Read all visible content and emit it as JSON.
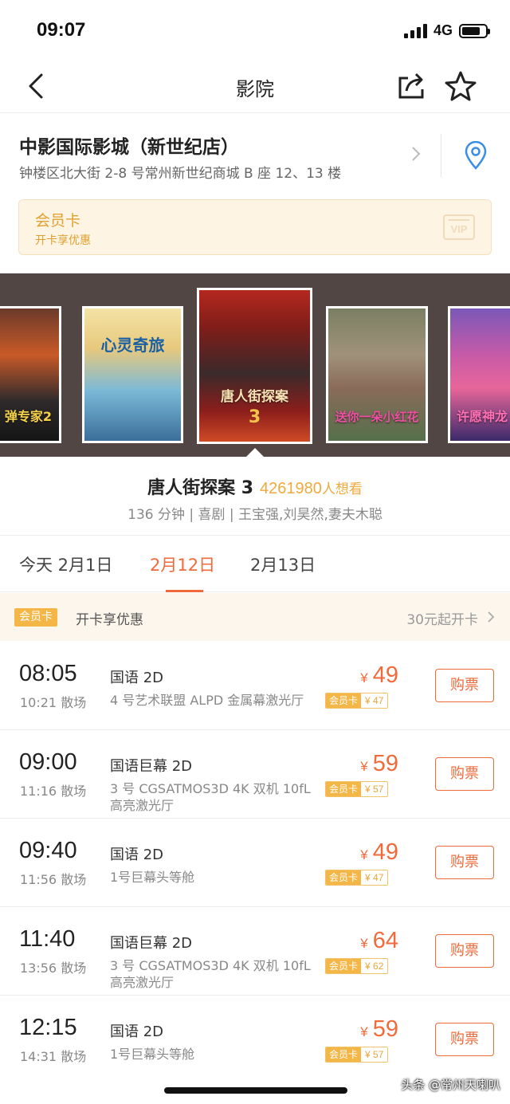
{
  "status_bar": {
    "time": "09:07",
    "network": "4G"
  },
  "nav": {
    "title": "影院",
    "icons": [
      "back-icon",
      "share-icon",
      "star-icon"
    ]
  },
  "cinema": {
    "name": "中影国际影城（新世纪店）",
    "address": "钟楼区北大街 2-8 号常州新世纪商城 B 座 12、13 楼"
  },
  "member_card": {
    "title": "会员卡",
    "subtitle": "开卡享优惠",
    "icon_text": "VIP"
  },
  "posters": [
    {
      "label": "弹专家2"
    },
    {
      "label": "心灵奇旅"
    },
    {
      "label": "唐人街探案",
      "number": "3"
    },
    {
      "label": "送你一朵小红花"
    },
    {
      "label": "许愿神龙"
    }
  ],
  "movie": {
    "title": "唐人街探案 3",
    "wants": "4261980",
    "wants_suffix": "人想看",
    "meta": "136 分钟 | 喜剧 | 王宝强,刘昊然,妻夫木聪"
  },
  "date_tabs": [
    {
      "label": "今天 2月1日",
      "active": false
    },
    {
      "label": "2月12日",
      "active": true
    },
    {
      "label": "2月13日",
      "active": false
    }
  ],
  "promo": {
    "badge": "会员卡",
    "text": "开卡享优惠",
    "right": "30元起开卡"
  },
  "currency": "¥",
  "member_tag": "会员卡",
  "buy_label": "购票",
  "showtimes": [
    {
      "start": "08:05",
      "end": "10:21 散场",
      "format": "国语 2D",
      "hall": "4 号艺术联盟 ALPD 金属幕激光厅",
      "price": "49",
      "member_price": "¥ 47"
    },
    {
      "start": "09:00",
      "end": "11:16 散场",
      "format": "国语巨幕 2D",
      "hall": "3 号 CGSATMOS3D 4K 双机 10fL 高亮激光厅",
      "price": "59",
      "member_price": "¥ 57"
    },
    {
      "start": "09:40",
      "end": "11:56 散场",
      "format": "国语 2D",
      "hall": "1号巨幕头等舱",
      "price": "49",
      "member_price": "¥ 47"
    },
    {
      "start": "11:40",
      "end": "13:56 散场",
      "format": "国语巨幕 2D",
      "hall": "3 号 CGSATMOS3D 4K 双机 10fL 高亮激光厅",
      "price": "64",
      "member_price": "¥ 62"
    },
    {
      "start": "12:15",
      "end": "14:31 散场",
      "format": "国语 2D",
      "hall": "1号巨幕头等舱",
      "price": "59",
      "member_price": "¥ 57"
    }
  ],
  "watermark": "头条 @常州天喇叭",
  "colors": {
    "accent": "#f06a3b",
    "gold": "#f0a93b",
    "carousel_bg": "#514644"
  }
}
